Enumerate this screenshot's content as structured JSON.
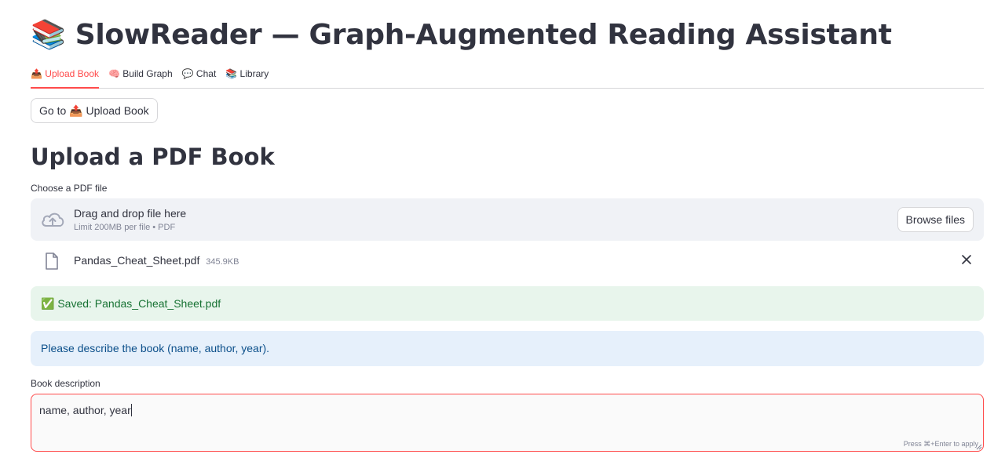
{
  "app": {
    "title": "📚 SlowReader — Graph-Augmented Reading Assistant"
  },
  "tabs": [
    {
      "label": "📤 Upload Book",
      "active": true
    },
    {
      "label": "🧠 Build Graph",
      "active": false
    },
    {
      "label": "💬 Chat",
      "active": false
    },
    {
      "label": "📚 Library",
      "active": false
    }
  ],
  "goto_button": "Go to 📤 Upload Book",
  "page": {
    "heading": "Upload a PDF Book"
  },
  "uploader": {
    "label": "Choose a PDF file",
    "drop_text": "Drag and drop file here",
    "limit_text": "Limit 200MB per file • PDF",
    "browse_label": "Browse files",
    "icon": "cloud-upload-icon"
  },
  "uploaded_file": {
    "name": "Pandas_Cheat_Sheet.pdf",
    "size": "345.9KB",
    "icon": "file-icon"
  },
  "alerts": {
    "success": "✅ Saved: Pandas_Cheat_Sheet.pdf",
    "info": "Please describe the book (name, author, year)."
  },
  "description": {
    "label": "Book description",
    "value": "name, author, year",
    "hint": "Press ⌘+Enter to apply"
  },
  "colors": {
    "accent": "#ff4b4b",
    "success_bg": "#e8f5ec",
    "info_bg": "#e6f0fb"
  }
}
